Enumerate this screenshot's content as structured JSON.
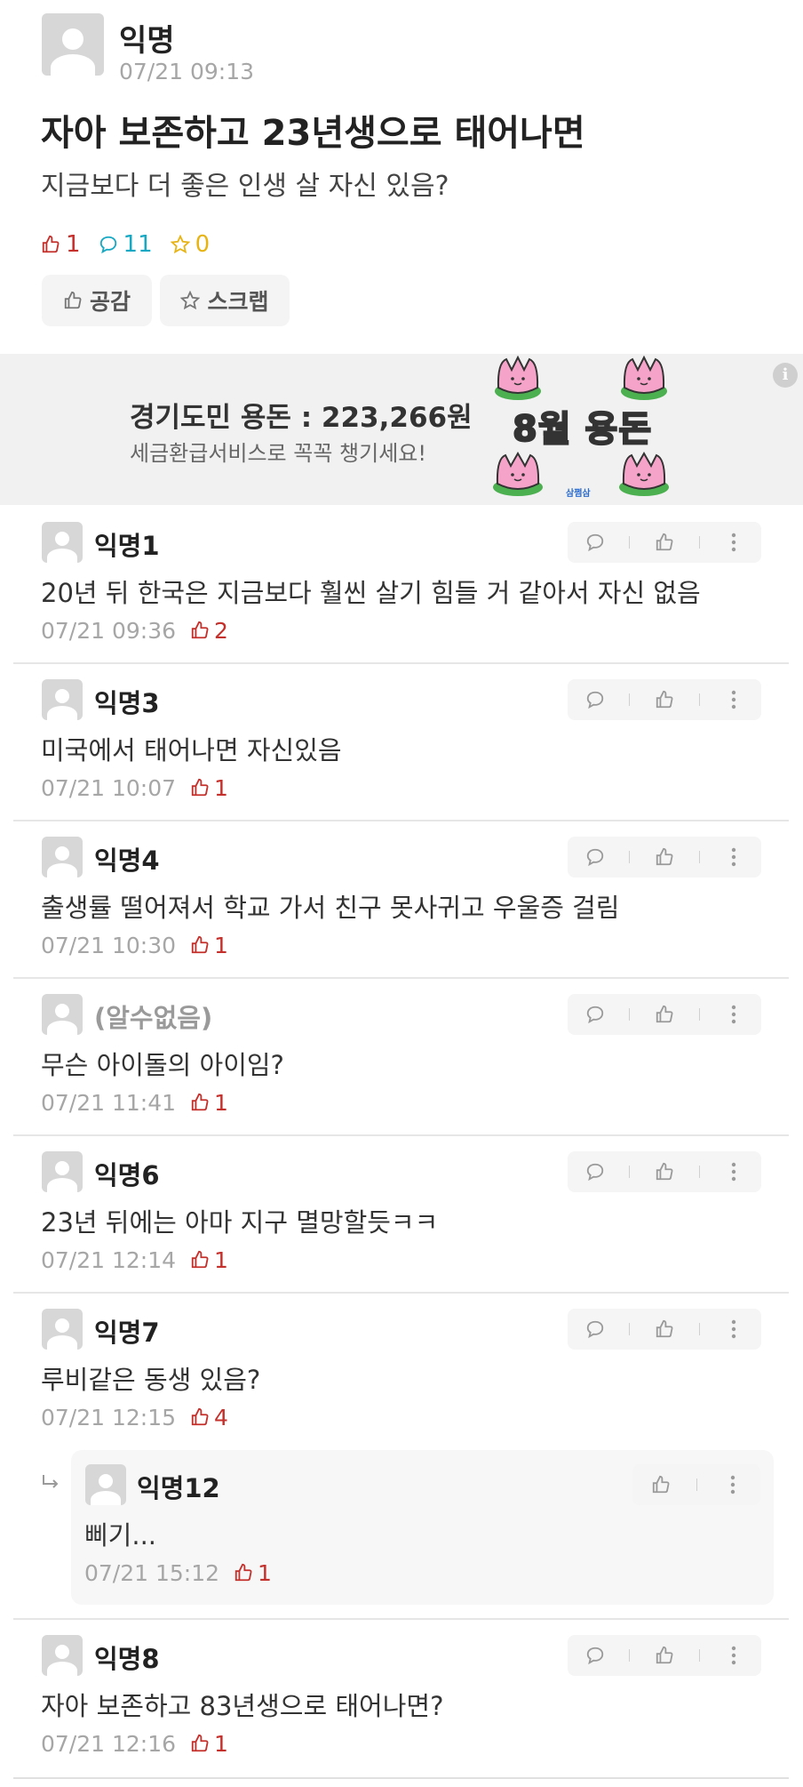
{
  "post": {
    "author": "익명",
    "time": "07/21 09:13",
    "title": "자아 보존하고 23년생으로 태어나면",
    "body": "지금보다 더 좋은 인생 살 자신 있음?",
    "likes": "1",
    "comments": "11",
    "scraps": "0",
    "empathy_label": "공감",
    "scrap_label": "스크랩"
  },
  "ad": {
    "title": "경기도민 용돈 : 223,266원",
    "subtitle": "세금환급서비스로 꼭꼭 챙기세요!",
    "art_text": "8월 용돈",
    "brand": "삼쩜삼",
    "info": "i"
  },
  "comments": [
    {
      "name": "익명1",
      "text": "20년 뒤 한국은 지금보다 훨씬 살기 힘들 거 같아서 자신 없음",
      "time": "07/21 09:36",
      "likes": "2"
    },
    {
      "name": "익명3",
      "text": "미국에서 태어나면 자신있음",
      "time": "07/21 10:07",
      "likes": "1"
    },
    {
      "name": "익명4",
      "text": "출생률 떨어져서 학교 가서 친구 못사귀고 우울증 걸림",
      "time": "07/21 10:30",
      "likes": "1"
    },
    {
      "name": "(알수없음)",
      "text": "무슨 아이돌의 아이임?",
      "time": "07/21 11:41",
      "likes": "1"
    },
    {
      "name": "익명6",
      "text": "23년 뒤에는 아마 지구 멸망할듯ㅋㅋ",
      "time": "07/21 12:14",
      "likes": "1"
    },
    {
      "name": "익명7",
      "text": "루비같은 동생 있음?",
      "time": "07/21 12:15",
      "likes": "4"
    },
    {
      "name": "익명8",
      "text": "자아 보존하고 83년생으로 태어나면?",
      "time": "07/21 12:16",
      "likes": "1"
    }
  ],
  "reply": {
    "name": "익명12",
    "text": "삐기...",
    "time": "07/21 15:12",
    "likes": "1"
  },
  "colors": {
    "like": "#c4302b",
    "comment": "#17a8c4",
    "scrap": "#e7b416",
    "tulip": "#f5a3c8",
    "leaf": "#4cb050"
  }
}
